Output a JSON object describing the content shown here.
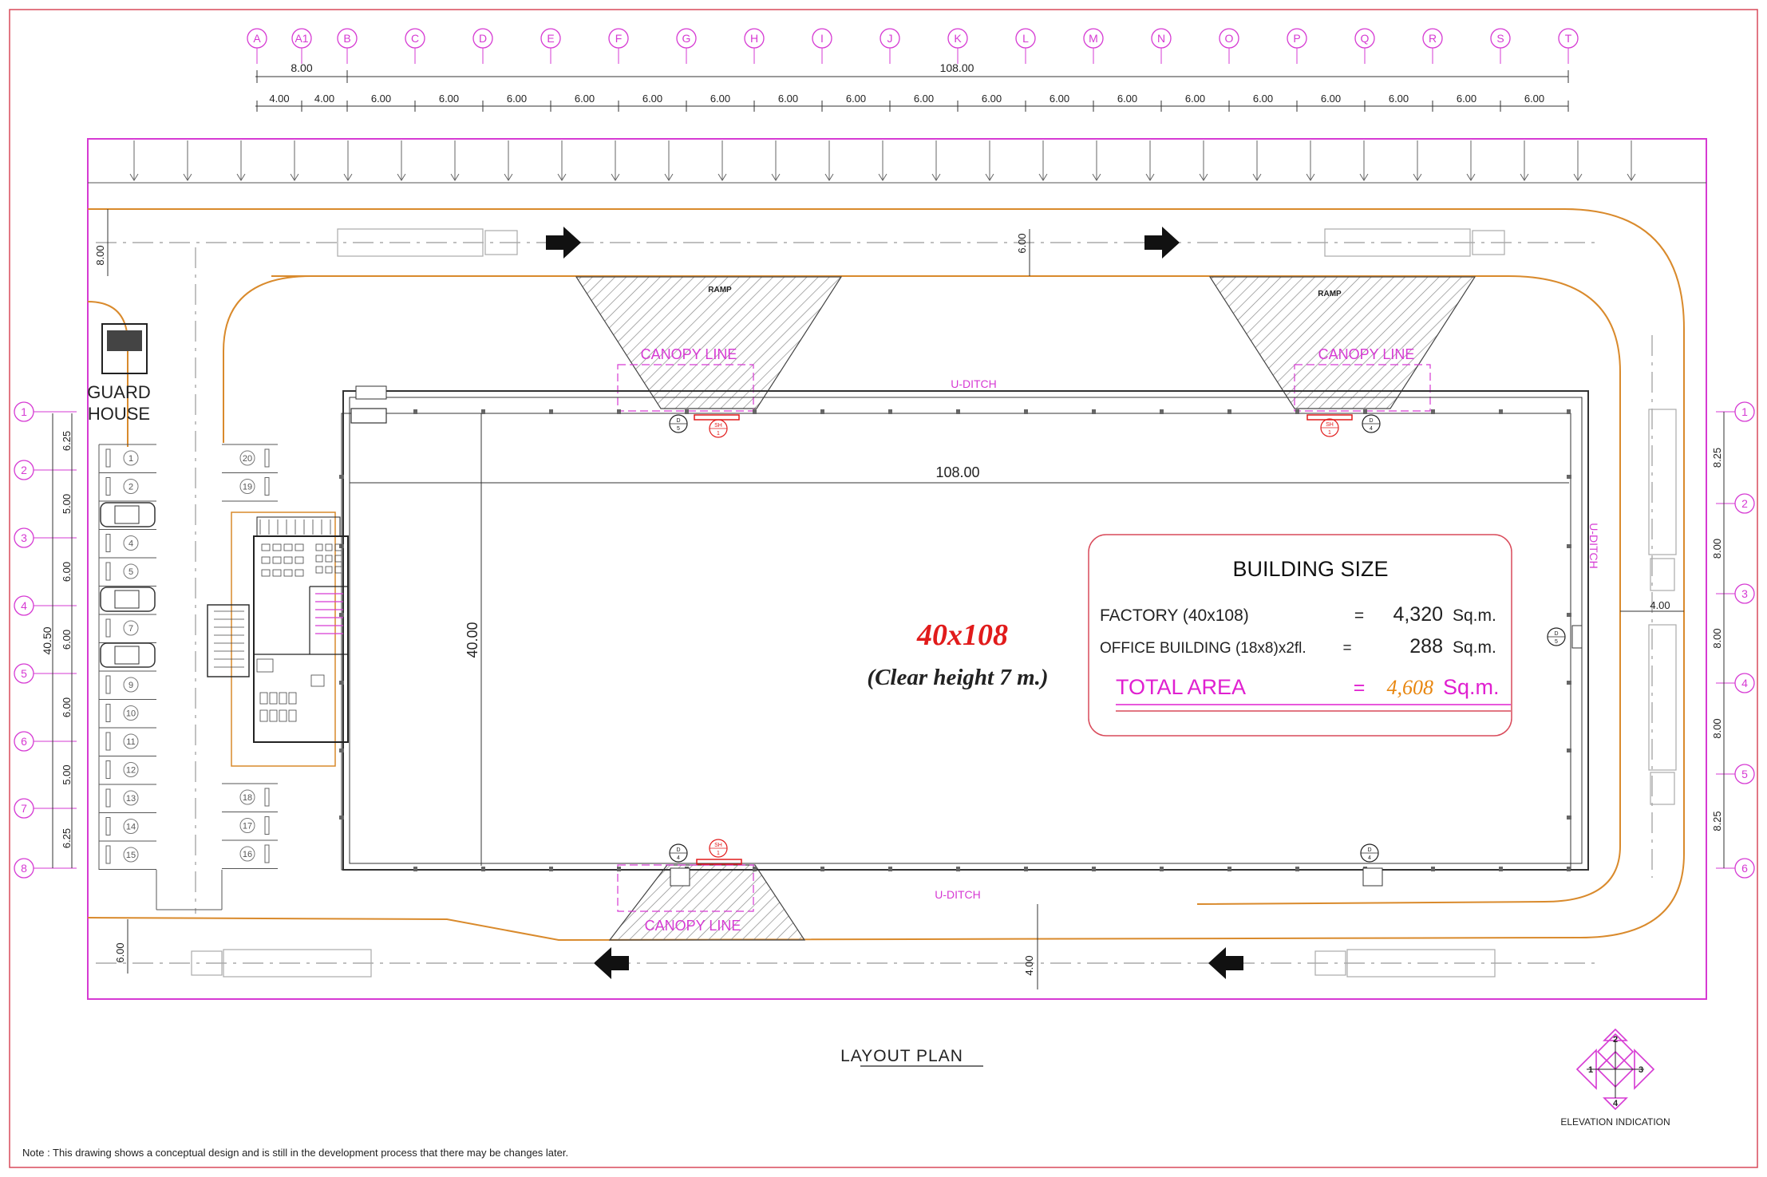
{
  "grid": {
    "columns": [
      "A",
      "A1",
      "B",
      "C",
      "D",
      "E",
      "F",
      "G",
      "H",
      "I",
      "J",
      "K",
      "L",
      "M",
      "N",
      "O",
      "P",
      "Q",
      "R",
      "S",
      "T"
    ],
    "rows_left": [
      "1",
      "2",
      "3",
      "4",
      "5",
      "6",
      "7",
      "8"
    ],
    "rows_right": [
      "1",
      "2",
      "3",
      "4",
      "5",
      "6"
    ]
  },
  "dimensions": {
    "top_total_left": "8.00",
    "top_total_right": "108.00",
    "top_bays": [
      "4.00",
      "4.00",
      "6.00",
      "6.00",
      "6.00",
      "6.00",
      "6.00",
      "6.00",
      "6.00",
      "6.00",
      "6.00",
      "6.00",
      "6.00",
      "6.00",
      "6.00",
      "6.00",
      "6.00",
      "6.00",
      "6.00",
      "6.00"
    ],
    "left_bays": [
      "6.25",
      "5.00",
      "6.00",
      "6.00",
      "6.00",
      "5.00",
      "6.25"
    ],
    "left_total": "40.50",
    "right_bays": [
      "8.25",
      "8.00",
      "8.00",
      "8.00",
      "8.25"
    ],
    "building_length": "108.00",
    "building_width": "40.00",
    "road_top_left": "8.00",
    "road_top_mid": "6.00",
    "road_right": "4.00",
    "road_bottom_left": "6.00",
    "road_bottom_mid": "4.00"
  },
  "labels": {
    "guard_house_line1": "GUARD",
    "guard_house_line2": "HOUSE",
    "ramp": "RAMP",
    "canopy_line": "CANOPY LINE",
    "u_ditch": "U-DITCH",
    "plan_title": "LAYOUT PLAN",
    "elevation_indication": "ELEVATION INDICATION",
    "note": "Note : This drawing shows a conceptual design and is still in the development process that there may be changes later."
  },
  "main_label": {
    "size": "40x108",
    "clear_height": "(Clear height 7 m.)"
  },
  "building_size": {
    "title": "BUILDING SIZE",
    "factory_label": "FACTORY  (40x108)",
    "factory_eq": "=",
    "factory_value": "4,320",
    "factory_unit": "Sq.m.",
    "office_label": "OFFICE BUILDING  (18x8)x2fl.",
    "office_eq": "=",
    "office_value": "288",
    "office_unit": "Sq.m.",
    "total_label": "TOTAL AREA",
    "total_eq": "=",
    "total_value": "4,608",
    "total_unit": "Sq.m."
  },
  "parking": {
    "left_slots": [
      "1",
      "2",
      "3",
      "4",
      "5",
      "6",
      "7",
      "8",
      "9",
      "10",
      "11",
      "12",
      "13",
      "14",
      "15"
    ],
    "right_slots_top": [
      "20",
      "19"
    ],
    "right_slots_bottom": [
      "18",
      "17",
      "16"
    ]
  },
  "door_tags": {
    "d5": "D\n5",
    "sh": "SH\n1",
    "d4": "D\n4"
  },
  "colors": {
    "grid_magenta": "#d63ad3",
    "site_orange": "#d98a2c",
    "title_red": "#e11b1b",
    "total_magenta": "#e020d0",
    "total_orange": "#e8860f",
    "frame_red": "#d94a5a"
  }
}
